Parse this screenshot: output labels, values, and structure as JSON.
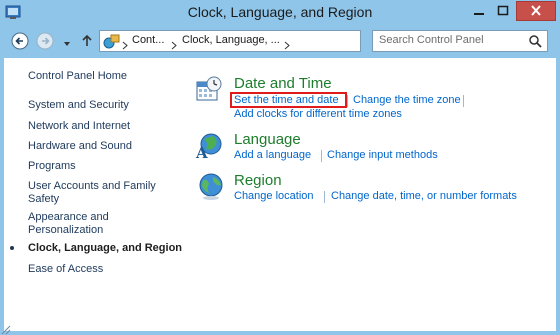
{
  "window": {
    "title": "Clock, Language, and Region"
  },
  "address": {
    "crumbs": [
      "Cont...",
      "Clock, Language, ..."
    ]
  },
  "search": {
    "placeholder": "Search Control Panel"
  },
  "sidebar": {
    "items": [
      {
        "label": "Control Panel Home"
      },
      {
        "label": "System and Security"
      },
      {
        "label": "Network and Internet"
      },
      {
        "label": "Hardware and Sound"
      },
      {
        "label": "Programs"
      },
      {
        "label": "User Accounts and Family\nSafety"
      },
      {
        "label": "Appearance and\nPersonalization"
      },
      {
        "label": "Clock, Language, and Region",
        "current": true
      },
      {
        "label": "Ease of Access"
      }
    ]
  },
  "categories": [
    {
      "title": "Date and Time",
      "icon": "calendar-clock-icon",
      "links": [
        "Set the time and date",
        "Change the time zone",
        "Add clocks for different time zones"
      ]
    },
    {
      "title": "Language",
      "icon": "language-globe-icon",
      "links": [
        "Add a language",
        "Change input methods"
      ]
    },
    {
      "title": "Region",
      "icon": "region-globe-icon",
      "links": [
        "Change location",
        "Change date, time, or number formats"
      ]
    }
  ],
  "colors": {
    "chrome": "#8ec5e9",
    "link": "#0066cc",
    "category_title": "#1e7d2d",
    "highlight": "#e01b1b",
    "close": "#c7504b"
  }
}
